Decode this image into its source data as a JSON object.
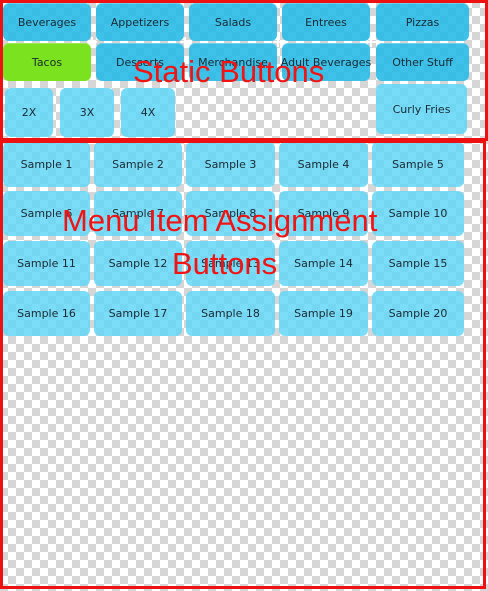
{
  "categories": {
    "row1": [
      "Beverages",
      "Appetizers",
      "Salads",
      "Entrees",
      "Pizzas"
    ],
    "row2": [
      "Tacos",
      "Desserts",
      "Merchandise",
      "Adult Beverages",
      "Other Stuff"
    ],
    "active": "Tacos",
    "active_color": "#7ae21f",
    "button_color": "#24bae6"
  },
  "modifiers": [
    "2X",
    "3X",
    "4X"
  ],
  "side_button": "Curly Fries",
  "menu_items": [
    "Sample 1",
    "Sample 2",
    "Sample 3",
    "Sample 4",
    "Sample 5",
    "Sample 6",
    "Sample 7",
    "Sample 8",
    "Sample 9",
    "Sample 10",
    "Sample 11",
    "Sample 12",
    "Sample 13",
    "Sample 14",
    "Sample 15",
    "Sample 16",
    "Sample 17",
    "Sample 18",
    "Sample 19",
    "Sample 20"
  ],
  "item_color": "#5ed6f7",
  "annotations": {
    "static": "Static Buttons",
    "menu_line1": "Menu Item Assignment",
    "menu_line2": "Buttons",
    "color": "#ee1111"
  }
}
